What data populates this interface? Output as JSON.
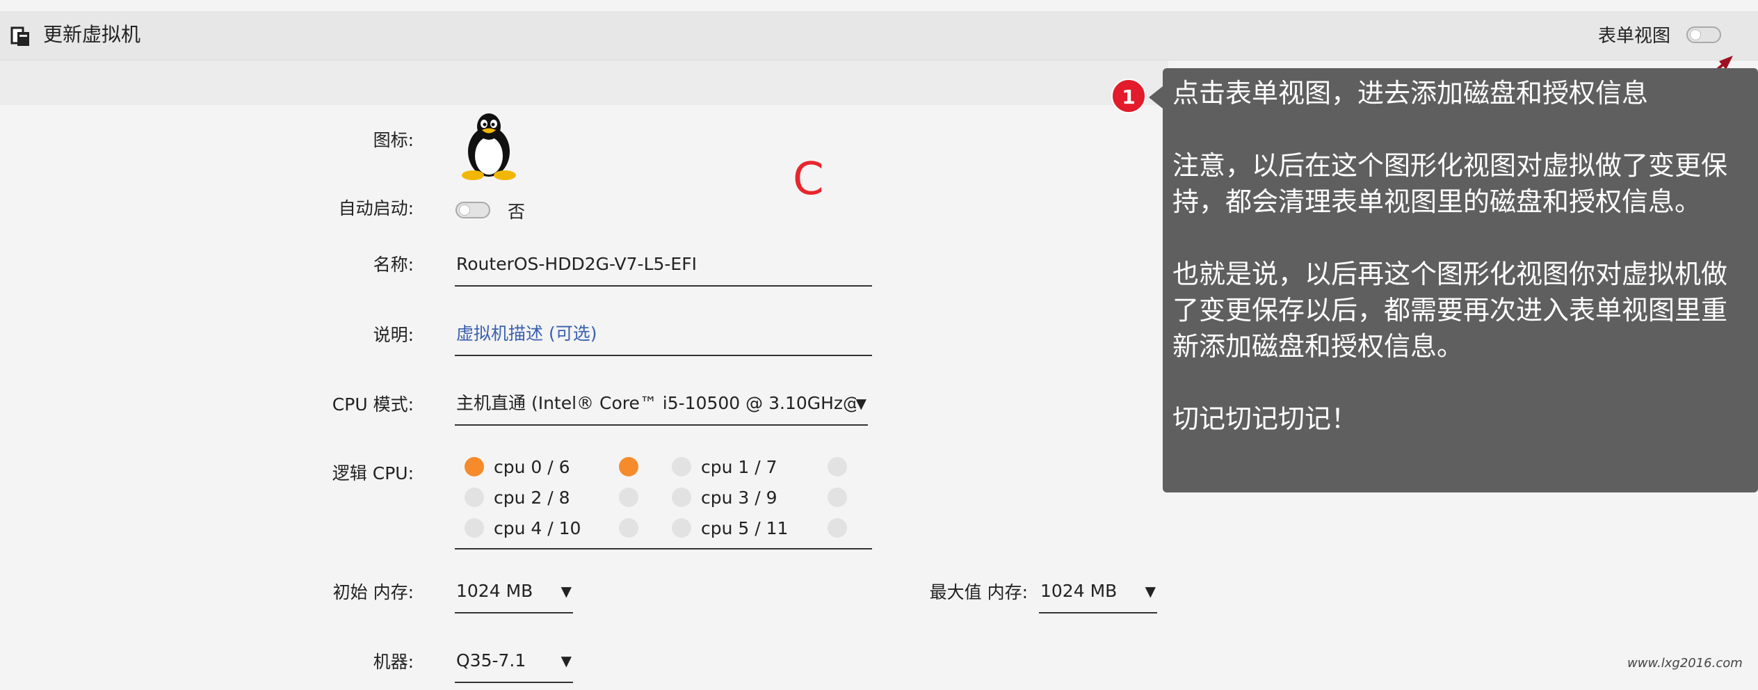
{
  "header": {
    "icon": "clipboard-copy-icon",
    "title": "更新虚拟机",
    "form_view_label": "表单视图",
    "form_view_enabled": false
  },
  "form": {
    "icon_label": "图标:",
    "icon_name": "linux-tux-icon",
    "autostart_label": "自动启动:",
    "autostart_enabled": false,
    "autostart_value": "否",
    "name_label": "名称:",
    "name_value": "RouterOS-HDD2G-V7-L5-EFI",
    "desc_label": "说明:",
    "desc_placeholder": "虚拟机描述 (可选)",
    "cpu_mode_label": "CPU 模式:",
    "cpu_mode_value": "主机直通 (Intel® Core™ i5-10500 @ 3.10GHz@)",
    "logical_cpu_label": "逻辑 CPU:",
    "cpus": [
      {
        "label": "cpu 0 / 6",
        "left_selected": true,
        "right_selected": true
      },
      {
        "label": "cpu 1 / 7",
        "left_selected": false,
        "right_selected": false
      },
      {
        "label": "cpu 2 / 8",
        "left_selected": false,
        "right_selected": false
      },
      {
        "label": "cpu 3 / 9",
        "left_selected": false,
        "right_selected": false
      },
      {
        "label": "cpu 4 / 10",
        "left_selected": false,
        "right_selected": false
      },
      {
        "label": "cpu 5 / 11",
        "left_selected": false,
        "right_selected": false
      }
    ],
    "init_mem_label": "初始 内存:",
    "init_mem_value": "1024 MB",
    "max_mem_label": "最大值 内存:",
    "max_mem_value": "1024 MB",
    "machine_label": "机器:",
    "machine_value": "Q35-7.1"
  },
  "annotation": {
    "badge": "1",
    "mark": "C",
    "text": "点击表单视图，进去添加磁盘和授权信息\n\n注意，以后在这个图形化视图对虚拟做了变更保持，都会清理表单视图里的磁盘和授权信息。\n\n也就是说，以后再这个图形化视图你对虚拟机做了变更保存以后，都需要再次进入表单视图里重新添加磁盘和授权信息。\n\n切记切记切记！"
  },
  "colors": {
    "accent": "#f68b2c",
    "callout_bg": "#5f5f5f",
    "badge_red": "#e21c2a"
  },
  "watermark": "www.lxg2016.com"
}
